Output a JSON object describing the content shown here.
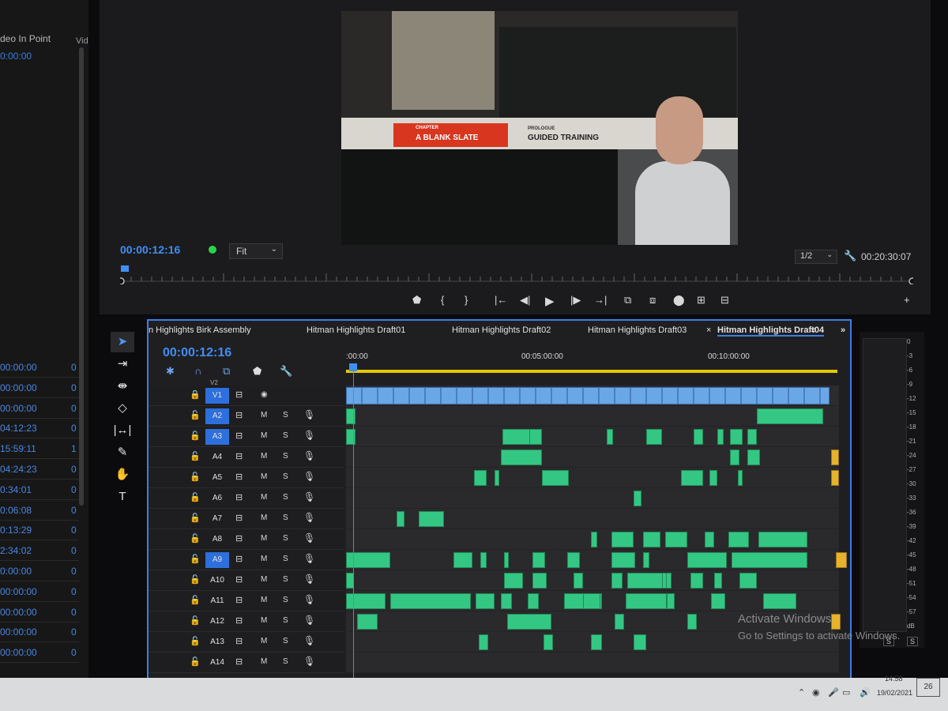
{
  "project_panel": {
    "header_in_point": "deo In Point",
    "header_video": "Vid",
    "first_timecode": "0:00:00",
    "rows": [
      {
        "tc": "00:00:00",
        "flag": "0"
      },
      {
        "tc": "00:00:00",
        "flag": "0"
      },
      {
        "tc": "00:00:00",
        "flag": "0"
      },
      {
        "tc": "04:12:23",
        "flag": "0"
      },
      {
        "tc": "15:59:11",
        "flag": "1"
      },
      {
        "tc": "04:24:23",
        "flag": "0"
      },
      {
        "tc": "0:34:01",
        "flag": "0"
      },
      {
        "tc": "0:06:08",
        "flag": "0"
      },
      {
        "tc": "0:13:29",
        "flag": "0"
      },
      {
        "tc": "2:34:02",
        "flag": "0"
      },
      {
        "tc": "0:00:00",
        "flag": "0"
      },
      {
        "tc": "00:00:00",
        "flag": "0"
      },
      {
        "tc": "00:00:00",
        "flag": "0"
      },
      {
        "tc": "00:00:00",
        "flag": "0"
      },
      {
        "tc": "00:00:00",
        "flag": "0"
      }
    ]
  },
  "monitor": {
    "video_overlay": {
      "red_card_small": "CHAPTER",
      "red_card_title": "A BLANK SLATE",
      "white_card_small": "PROLOGUE",
      "white_card_title": "GUIDED TRAINING"
    },
    "current_timecode": "00:00:12:16",
    "zoom_select": "Fit",
    "resolution_select": "1/2",
    "duration_timecode": "00:20:30:07",
    "colors": {
      "accent": "#3f8ef5",
      "status": "#2bd34a",
      "overlay_red": "#d9361f"
    },
    "controls": [
      {
        "name": "add-marker",
        "glyph": "⬟"
      },
      {
        "name": "mark-in",
        "glyph": "{"
      },
      {
        "name": "mark-out",
        "glyph": "}"
      },
      {
        "name": "go-to-in",
        "glyph": "|←"
      },
      {
        "name": "step-back",
        "glyph": "◀|"
      },
      {
        "name": "play",
        "glyph": "▶"
      },
      {
        "name": "step-forward",
        "glyph": "|▶"
      },
      {
        "name": "go-to-out",
        "glyph": "→|"
      },
      {
        "name": "lift",
        "glyph": "⧉"
      },
      {
        "name": "extract",
        "glyph": "⧈"
      },
      {
        "name": "export-frame",
        "glyph": "⬤"
      },
      {
        "name": "insert",
        "glyph": "⊞"
      },
      {
        "name": "overwrite",
        "glyph": "⊟"
      },
      {
        "name": "add-button",
        "glyph": "+"
      }
    ]
  },
  "tools": [
    {
      "name": "selection-tool",
      "glyph": "➤"
    },
    {
      "name": "track-select-tool",
      "glyph": "⇥"
    },
    {
      "name": "ripple-edit-tool",
      "glyph": "⇼"
    },
    {
      "name": "razor-tool",
      "glyph": "◇"
    },
    {
      "name": "slip-tool",
      "glyph": "|↔|"
    },
    {
      "name": "pen-tool",
      "glyph": "✎"
    },
    {
      "name": "hand-tool",
      "glyph": "✋"
    },
    {
      "name": "type-tool",
      "glyph": "T"
    }
  ],
  "timeline": {
    "tabs": [
      "n Highlights Birk Assembly",
      "Hitman Highlights Draft01",
      "Hitman Highlights Draft02",
      "Hitman Highlights Draft03",
      "Hitman Highlights Draft04"
    ],
    "active_tab_close": "×",
    "active_tab_menu": "≡",
    "overflow": "»",
    "timecode": "00:00:12:16",
    "ruler_labels": [
      ":00:00",
      "00:05:00:00",
      "00:10:00:00"
    ],
    "video_track": {
      "name": "V1",
      "label_above": "V2"
    },
    "audio_tracks": [
      {
        "name": "A2",
        "targeted": true
      },
      {
        "name": "A3",
        "targeted": true
      },
      {
        "name": "A4",
        "targeted": false
      },
      {
        "name": "A5",
        "targeted": false
      },
      {
        "name": "A6",
        "targeted": false
      },
      {
        "name": "A7",
        "targeted": false
      },
      {
        "name": "A8",
        "targeted": false
      },
      {
        "name": "A9",
        "targeted": true
      },
      {
        "name": "A10",
        "targeted": false
      },
      {
        "name": "A11",
        "targeted": false
      },
      {
        "name": "A12",
        "targeted": false
      },
      {
        "name": "A13",
        "targeted": false
      },
      {
        "name": "A14",
        "targeted": false
      }
    ],
    "mute_label": "M",
    "solo_label": "S"
  },
  "meter": {
    "scale": [
      "0",
      "-3",
      "-6",
      "-9",
      "-12",
      "-15",
      "-18",
      "-21",
      "-24",
      "-27",
      "-30",
      "-33",
      "-36",
      "-39",
      "-42",
      "-45",
      "-48",
      "-51",
      "-54",
      "-57",
      "dB"
    ],
    "solo_left": "S",
    "solo_right": "S"
  },
  "watermark": {
    "line1": "Activate Windows",
    "line2": "Go to Settings to activate Windows."
  },
  "taskbar": {
    "time": "14:58",
    "date": "19/02/2021",
    "notifications": "26"
  }
}
